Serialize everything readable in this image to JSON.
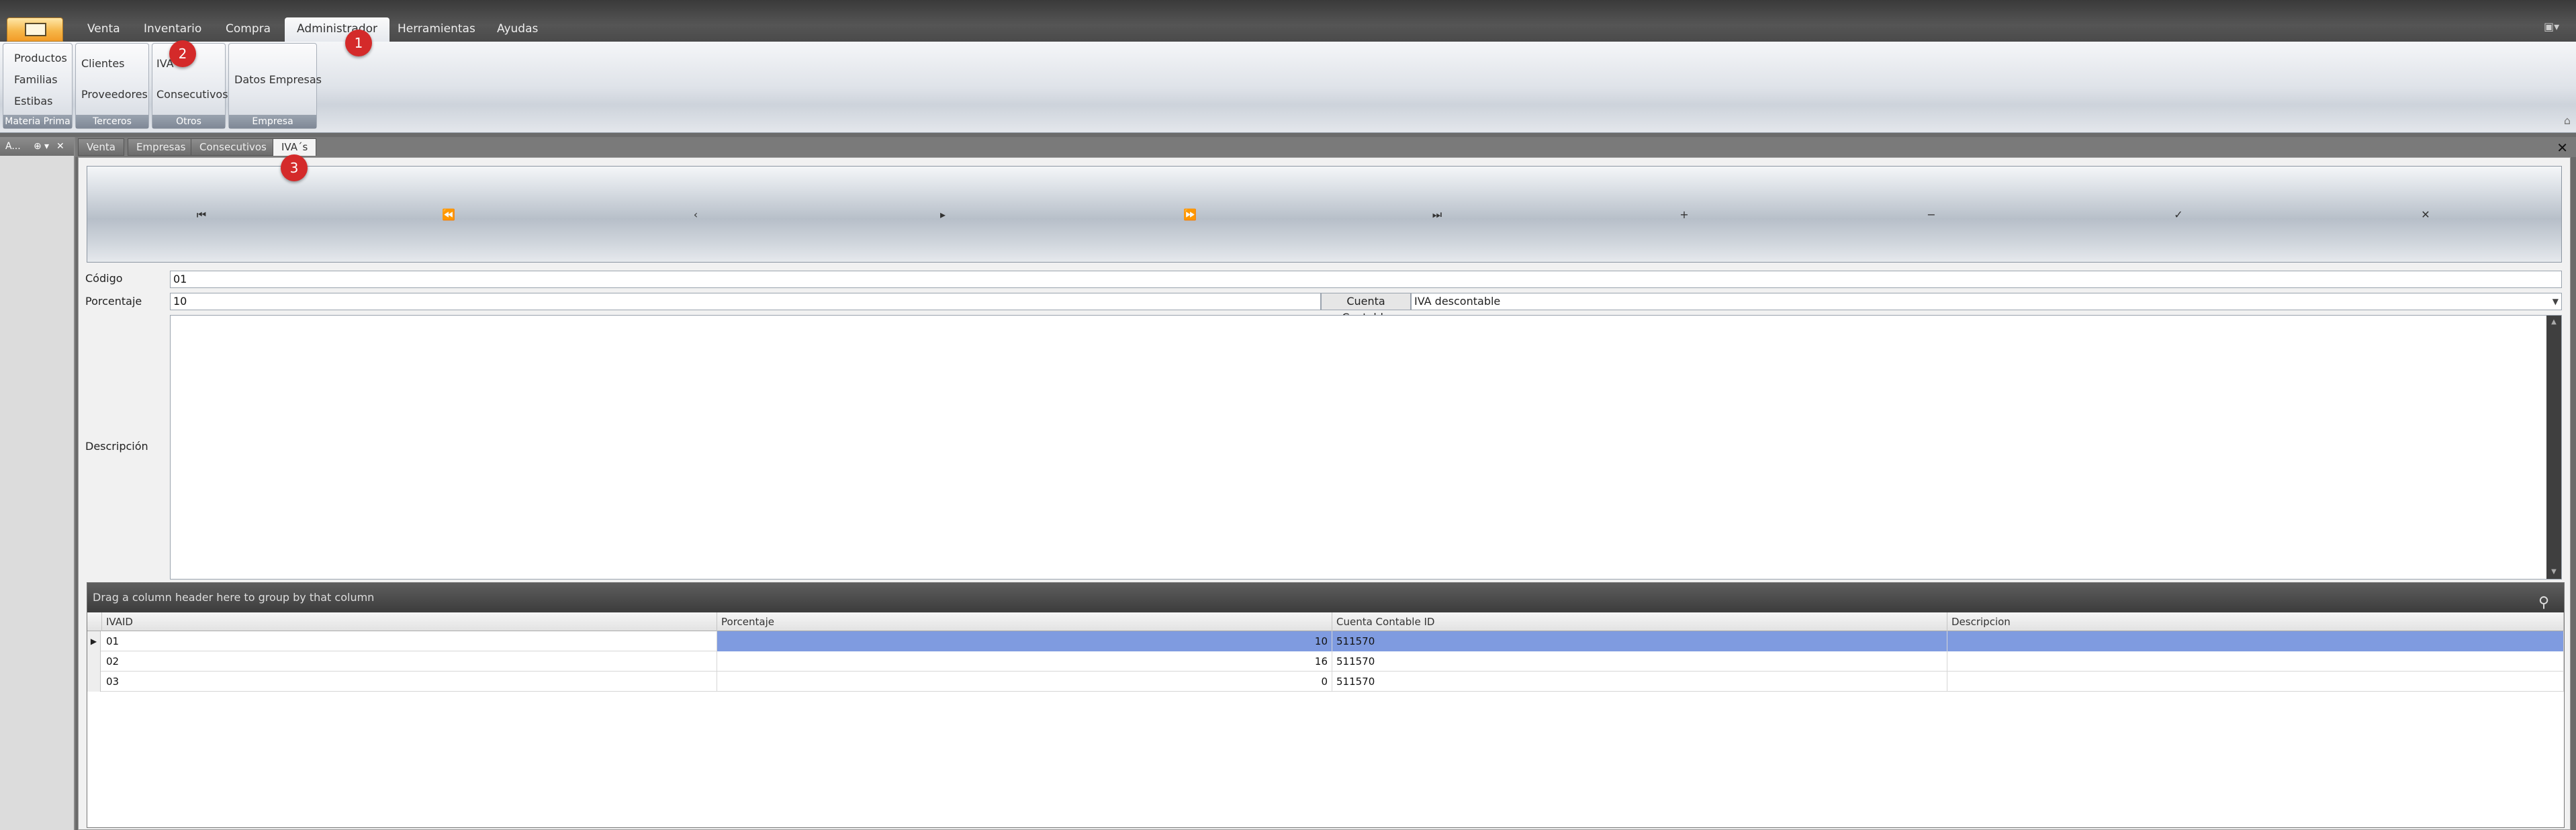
{
  "menu": {
    "tabs": [
      {
        "label": "Venta"
      },
      {
        "label": "Inventario"
      },
      {
        "label": "Compra"
      },
      {
        "label": "Administrador"
      },
      {
        "label": "Herramientas"
      },
      {
        "label": "Ayudas"
      }
    ],
    "active_tab": "Administrador"
  },
  "ribbon": {
    "groups": [
      {
        "caption": "Materia Prima",
        "items": [
          "Productos",
          "Familias",
          "Estibas"
        ]
      },
      {
        "caption": "Terceros",
        "items": [
          "Clientes",
          "Proveedores"
        ]
      },
      {
        "caption": "Otros",
        "items": [
          "IVA",
          "Consecutivos"
        ]
      },
      {
        "caption": "Empresa",
        "items": [
          "Datos Empresas"
        ]
      }
    ]
  },
  "left_dock": {
    "title": "A..."
  },
  "doc_tabs": [
    {
      "label": "Venta"
    },
    {
      "label": "Empresas"
    },
    {
      "label": "Consecutivos"
    },
    {
      "label": "IVA´s"
    }
  ],
  "navigator": {
    "buttons": [
      "first-icon",
      "prev-page-icon",
      "prev-icon",
      "next-icon",
      "next-page-icon",
      "last-icon",
      "add-icon",
      "remove-icon",
      "save-icon",
      "cancel-icon"
    ]
  },
  "form": {
    "codigo_label": "Código",
    "codigo_value": "01",
    "porcentaje_label": "Porcentaje",
    "porcentaje_value": "10",
    "cuenta_label": "Cuenta Contable",
    "cuenta_value": "IVA descontable",
    "descripcion_label": "Descripción",
    "descripcion_value": ""
  },
  "grid": {
    "group_panel_text": "Drag a column header here to group by that column",
    "columns": [
      "IVAID",
      "Porcentaje",
      "Cuenta Contable ID",
      "Descripcion"
    ],
    "rows": [
      {
        "IVAID": "01",
        "Porcentaje": "10",
        "CuentaContableID": "511570",
        "Descripcion": "",
        "selected": true
      },
      {
        "IVAID": "02",
        "Porcentaje": "16",
        "CuentaContableID": "511570",
        "Descripcion": "",
        "selected": false
      },
      {
        "IVAID": "03",
        "Porcentaje": "0",
        "CuentaContableID": "511570",
        "Descripcion": "",
        "selected": false
      }
    ]
  },
  "callouts": [
    "1",
    "2",
    "3"
  ],
  "colors": {
    "selection": "#7f9be0",
    "callout": "#d42a2a",
    "app_button": "#f6b74a"
  }
}
